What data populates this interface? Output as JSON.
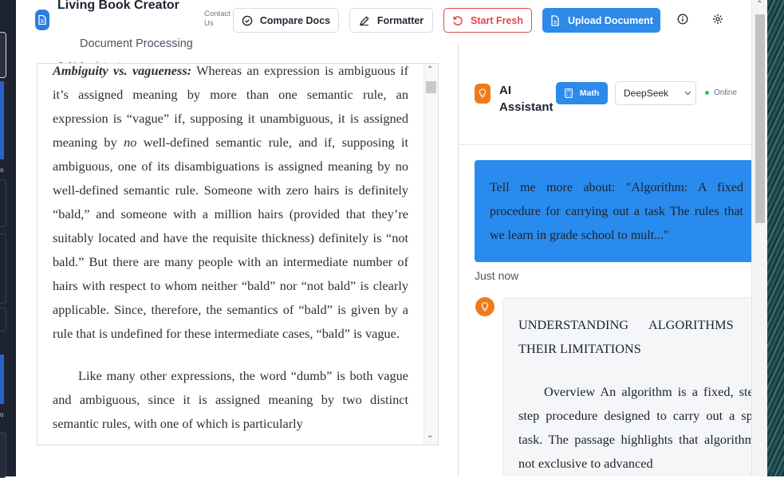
{
  "header": {
    "app_title": "Living Book Creator",
    "contact_label": "Contact Us",
    "subtitle_line1": "Document Processing",
    "subtitle_line2": "& AI Assistant",
    "buttons": {
      "compare": "Compare Docs",
      "formatter": "Formatter",
      "start_fresh": "Start Fresh",
      "upload": "Upload Document"
    }
  },
  "document": {
    "para1_heading": "Ambiguity vs. vagueness:",
    "para1_a": " Whereas an expression is ambiguous if it’s assigned meaning by more than one semantic rule, an expression is “vague” if, supposing it unambiguous, it is assigned meaning by ",
    "para1_em": "no",
    "para1_b": " well-defined semantic rule, and if, supposing it ambiguous, one of its disambiguations is assigned meaning by no well-defined semantic rule. Someone with zero hairs is definitely “bald,” and someone with a million hairs (provided that they’re suitably located and have the requisite thickness) definitely is “not bald.” But there are many people with an intermediate number of hairs with respect to whom neither “bald” nor “not bald” is clearly applicable. Since, therefore, the semantics of “bald” is given by a rule that is undefined for these intermediate cases, “bald” is vague.",
    "para2": "Like many other expressions, the word “dumb” is both vague and ambiguous, since it is assigned meaning by two distinct semantic rules, with one of which is particularly"
  },
  "assistant": {
    "title": "AI Assistant",
    "math_label": "Math",
    "model": "DeepSeek",
    "status": "Online",
    "user_message": "Tell me more about: \"Algorithm: A fixed procedure for carrying out a task The rules that we learn in grade school to mult...\"",
    "timestamp": "Just now",
    "bot_heading": "UNDERSTANDING ALGORITHMS AND THEIR LIMITATIONS",
    "bot_body": "Overview An algorithm is a fixed, step-by-step procedure designed to carry out a specific task. The passage highlights that algorithms are not exclusive to advanced"
  },
  "colors": {
    "accent": "#2c8ae8",
    "danger": "#e04848",
    "assistant_orange": "#f07a1a",
    "online": "#22c55e"
  },
  "icons": [
    "document-icon",
    "check-circle-icon",
    "edit-icon",
    "refresh-icon",
    "upload-doc-icon",
    "info-icon",
    "gear-icon",
    "lightbulb-icon"
  ]
}
